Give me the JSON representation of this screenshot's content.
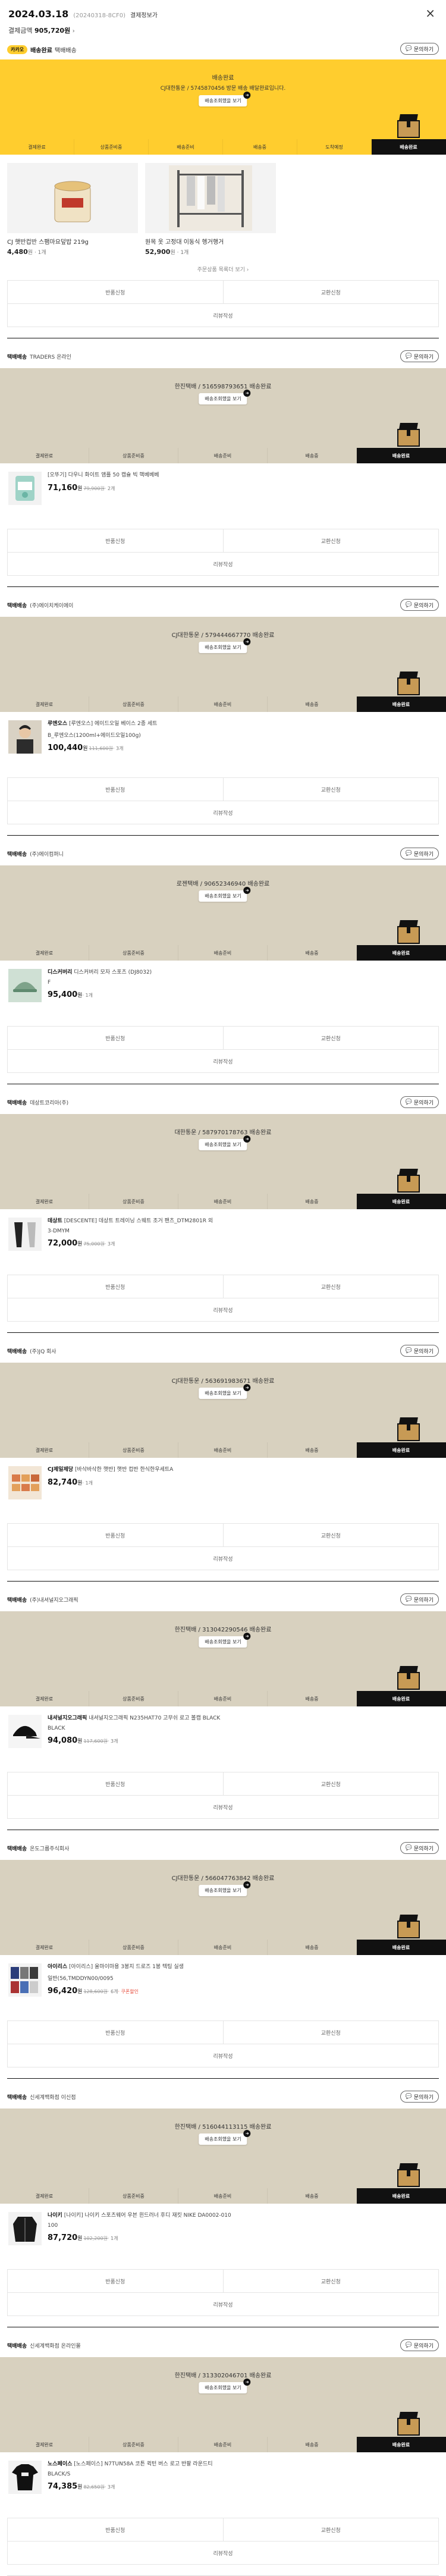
{
  "header": {
    "date": "2024.03.18",
    "order_no": "(20240318-8CF0)",
    "detail_link": "결제정보가",
    "close_icon": "×",
    "total_label": "결제금액",
    "total_value": "905,720원",
    "chevron": "›"
  },
  "common": {
    "inquiry": "문의하기",
    "seller_label": "택배배송",
    "track": "배송조회했을 보기",
    "steps": [
      "결제완료",
      "상품준비중",
      "배송준비",
      "배송중",
      "배송완료"
    ],
    "steps_first": [
      "결제완료",
      "상품준비중",
      "배송준비",
      "배송중",
      "도착예정",
      "배송완료"
    ],
    "return": "반품신청",
    "exchange": "교환신청",
    "review": "리뷰작성"
  },
  "first_order": {
    "badge": "카카오",
    "shop": "배송완료",
    "shop_sub": "택배배송",
    "banner_title": "배송완료",
    "banner_sub": "CJ대한통운 / 5745870456 방문 배송 배달완료입니다.",
    "products": [
      {
        "name": "CJ 햇반컵반 스팸마요덮밥 219g",
        "price": "4,480",
        "unit": "원 · 1개"
      },
      {
        "name": "원목 옷 고정대 이동식 헹거행거",
        "price": "52,900",
        "unit": "원 · 1개"
      }
    ],
    "more": "주문상품 목록더 보기 ›"
  },
  "orders": [
    {
      "seller": "TRADERS 온라인",
      "courier": "한진택배 / 516598793651 배송완료",
      "brand": "",
      "name": "[오뚜기] 다우니 화이트 앰플 50 캡슐 빅 핵베베베",
      "option": "",
      "price": "71,160",
      "orig": "79,900원",
      "qty": "· 2개",
      "coupon": "",
      "thumb": "pouch"
    },
    {
      "seller": "(주)에이치케이에이",
      "courier": "CJ대한통운 / 579444667770 배송완료",
      "brand": "루엔오스",
      "name": "[루엔오스] 에이드오일 베이스 2종 세트",
      "option": "B_루엔오스(1200ml+에이드오일100g)",
      "price": "100,440",
      "orig": "111,600원",
      "qty": "· 3개",
      "coupon": "",
      "thumb": "person"
    },
    {
      "seller": "(주)에이컴퍼니",
      "courier": "로젠택배 / 90652346940 배송완료",
      "brand": "디스커버리",
      "name": "디스커버리 모자 스포츠 (DJ8032)",
      "option": "F",
      "price": "95,400",
      "orig": "",
      "qty": "· 1개",
      "coupon": "",
      "thumb": "hat"
    },
    {
      "seller": "데상트코리아(주)",
      "courier": "대한통운 / 587970178763 배송완료",
      "brand": "데상트",
      "name": "[DESCENTE] 데상트 트레이닝 스웨트 조거 팬츠_DTM2801R 외",
      "option": "3-DMYM",
      "price": "72,000",
      "orig": "75,000원",
      "qty": "· 3개",
      "coupon": "",
      "thumb": "pants"
    },
    {
      "seller": "(주)JQ 회사",
      "courier": "CJ대한통운 / 563691983671 배송완료",
      "brand": "CJ제일제당",
      "name": "[바삭바삭한 햇반] 햇반 컵반 한식한우세트A",
      "option": "",
      "price": "82,740",
      "orig": "",
      "qty": "· 1개",
      "coupon": "",
      "thumb": "food"
    },
    {
      "seller": "(주)내셔널지오그래픽",
      "courier": "한진택배 / 313042290546 배송완료",
      "brand": "내셔널지오그래픽",
      "name": "내셔널지오그래픽 N235HAT70 고무쉬 로고 볼캡 BLACK",
      "option": "BLACK",
      "price": "94,080",
      "orig": "117,600원",
      "qty": "· 3개",
      "coupon": "",
      "thumb": "cap"
    },
    {
      "seller": "온도그룹주식회사",
      "courier": "CJ대한통운 / 566047763842 배송완료",
      "brand": "아이리스",
      "name": "[아이리스] 울마이마용 3봉지 드로즈 1봉 텍팅 실생",
      "option": "일반(56,TMDDYN00/0095",
      "price": "96,420",
      "orig": "128,600원",
      "qty": "· 6개",
      "coupon": "· 쿠폰할인",
      "thumb": "boxes"
    },
    {
      "seller": "신세계백화점 이신점",
      "courier": "한진택배 / 516044113115 배송완료",
      "brand": "나이키",
      "name": "[나이키] 나이키 스포츠웨어 우븐 윈드러너 후디 재킷 NIKE DA0002-010",
      "option": "100",
      "price": "87,720",
      "orig": "102,200원",
      "qty": "· 1개",
      "coupon": "",
      "thumb": "jacket"
    },
    {
      "seller": "신세계백화점 온라인몰",
      "courier": "한진택배 / 313302046701 배송완료",
      "brand": "노스페이스",
      "name": "[노스페이스] N7TUN58A 코튼 퀵턴 버스 로고 반팔 라운드티",
      "option": "BLACK/S",
      "price": "74,385",
      "orig": "82,650원",
      "qty": "· 3개",
      "coupon": "",
      "thumb": "tee"
    }
  ]
}
